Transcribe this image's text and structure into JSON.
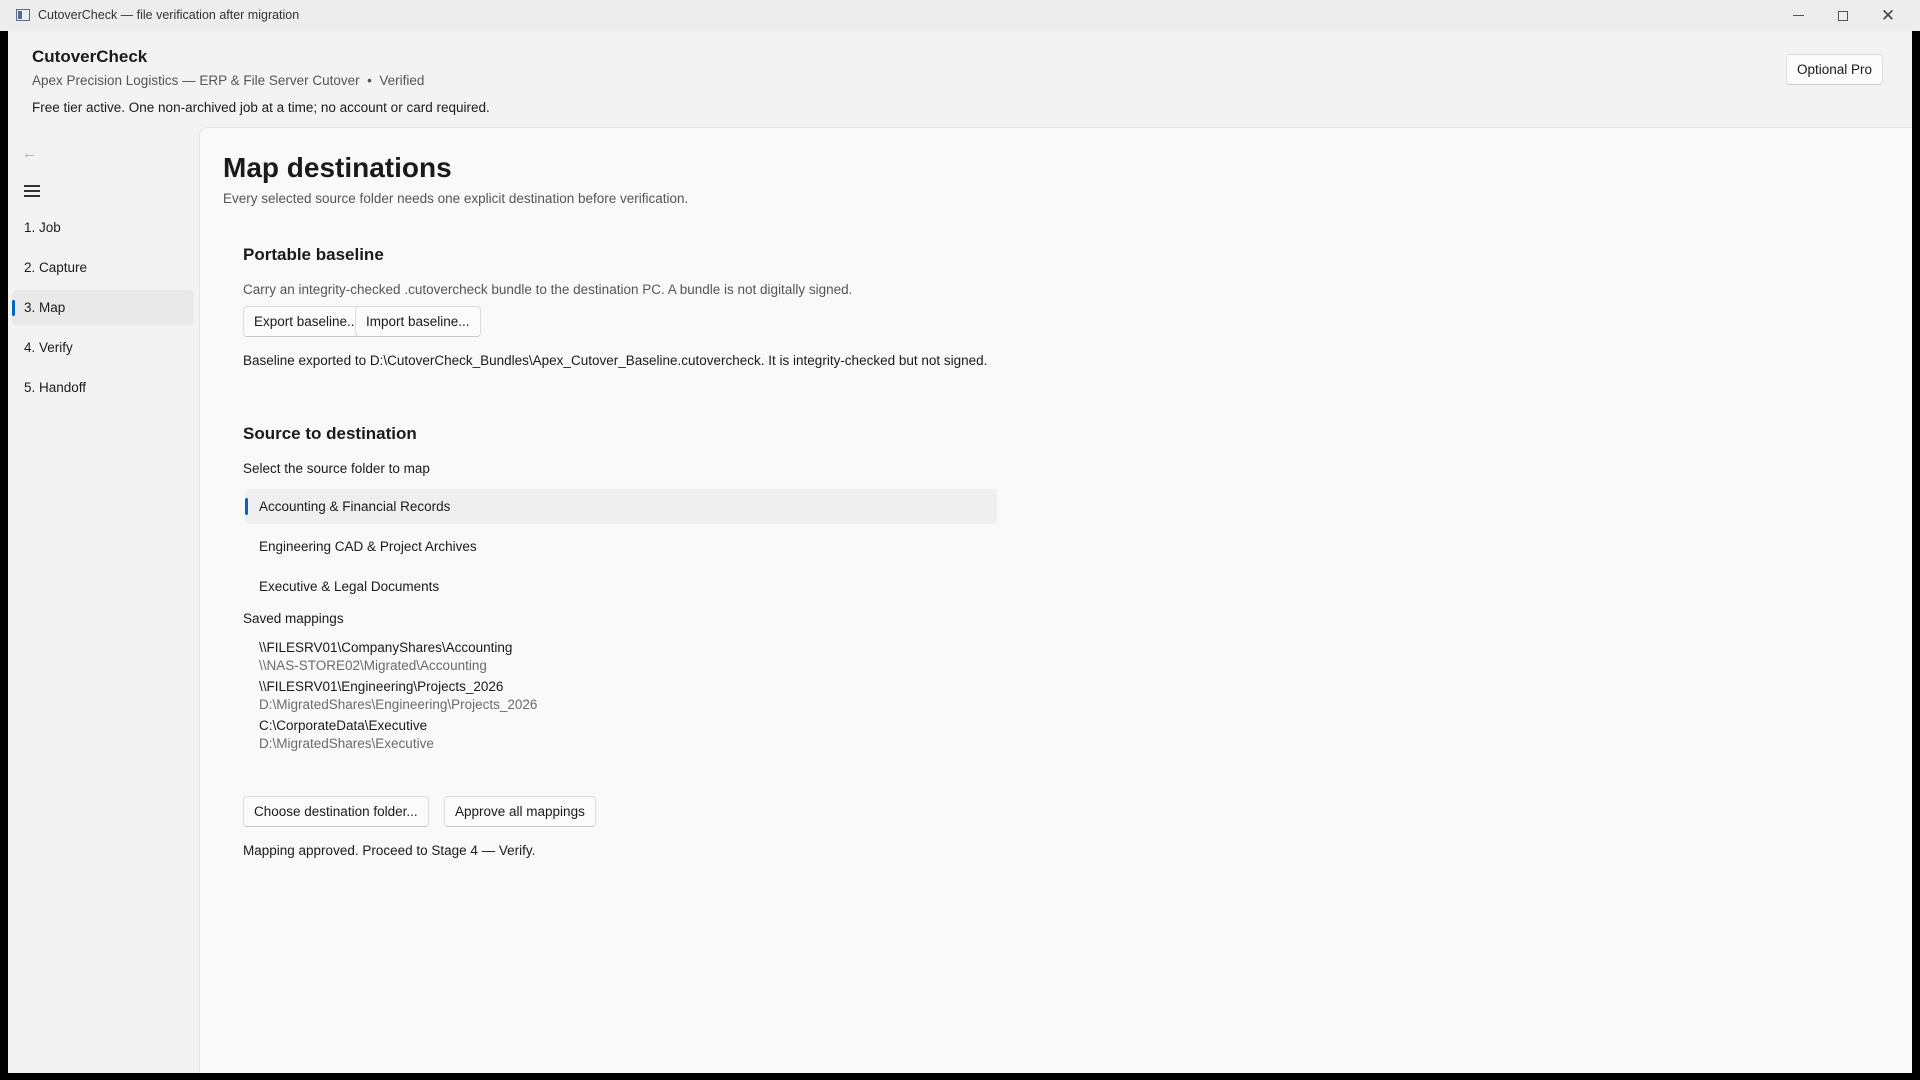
{
  "window": {
    "title": "CutoverCheck — file verification after migration",
    "minimize_icon": "minimize-icon",
    "maximize_icon": "maximize-icon",
    "close_label": "✕"
  },
  "header": {
    "app_name": "CutoverCheck",
    "job_line": "Apex Precision Logistics — ERP & File Server Cutover  •  Verified",
    "tier_notice": "Free tier active. One non-archived job at a time; no account or card required.",
    "pro_button": "Optional Pro"
  },
  "nav": {
    "back_icon": "←",
    "items": [
      {
        "label": "1. Job"
      },
      {
        "label": "2. Capture"
      },
      {
        "label": "3. Map",
        "active": true
      },
      {
        "label": "4. Verify"
      },
      {
        "label": "5. Handoff"
      }
    ]
  },
  "page": {
    "title": "Map destinations",
    "subtitle": "Every selected source folder needs one explicit destination before verification."
  },
  "baseline": {
    "title": "Portable baseline",
    "description": "Carry an integrity-checked .cutovercheck bundle to the destination PC. A bundle is not digitally signed.",
    "export_button": "Export baseline...",
    "import_button": "Import baseline...",
    "status": "Baseline exported to D:\\CutoverCheck_Bundles\\Apex_Cutover_Baseline.cutovercheck. It is integrity-checked but not signed."
  },
  "mapping": {
    "title": "Source to destination",
    "select_label": "Select the source folder to map",
    "folders": [
      {
        "label": "Accounting & Financial Records",
        "selected": true
      },
      {
        "label": "Engineering CAD & Project Archives"
      },
      {
        "label": "Executive & Legal Documents"
      }
    ],
    "saved_label": "Saved mappings",
    "saved": [
      {
        "source": "\\\\FILESRV01\\CompanyShares\\Accounting",
        "destination": "\\\\NAS-STORE02\\Migrated\\Accounting"
      },
      {
        "source": "\\\\FILESRV01\\Engineering\\Projects_2026",
        "destination": "D:\\MigratedShares\\Engineering\\Projects_2026"
      },
      {
        "source": "C:\\CorporateData\\Executive",
        "destination": "D:\\MigratedShares\\Executive"
      }
    ],
    "choose_button": "Choose destination folder...",
    "approve_button": "Approve all mappings",
    "status": "Mapping approved. Proceed to Stage 4 — Verify."
  },
  "colors": {
    "accent": "#0067c0",
    "background": "#f3f3f3",
    "content_background": "#f9f9f9"
  }
}
